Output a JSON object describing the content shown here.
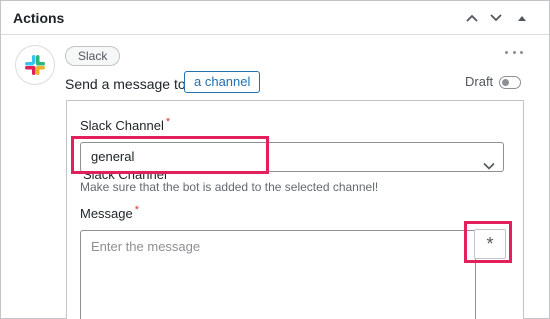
{
  "panel": {
    "title": "Actions"
  },
  "header_controls": {
    "up": "chevron-up-icon",
    "down": "chevron-down-icon",
    "collapse": "triangle-up-icon"
  },
  "action": {
    "integration_badge": "Slack",
    "sentence_prefix": "Send a message to",
    "channel_button": "a channel",
    "status_label": "Draft",
    "status_enabled": false
  },
  "fields": {
    "channel_label": "Slack Channel",
    "channel_required_mark": "*",
    "channel_value": "general",
    "channel_hint": "Make sure that the bot is added to the selected channel!",
    "message_label": "Message",
    "message_required_mark": "*",
    "message_placeholder": "Enter the message",
    "merge_tag_symbol": "*"
  },
  "colors": {
    "highlight": "#e2205c",
    "link": "#2271b1",
    "required": "#d63638"
  }
}
